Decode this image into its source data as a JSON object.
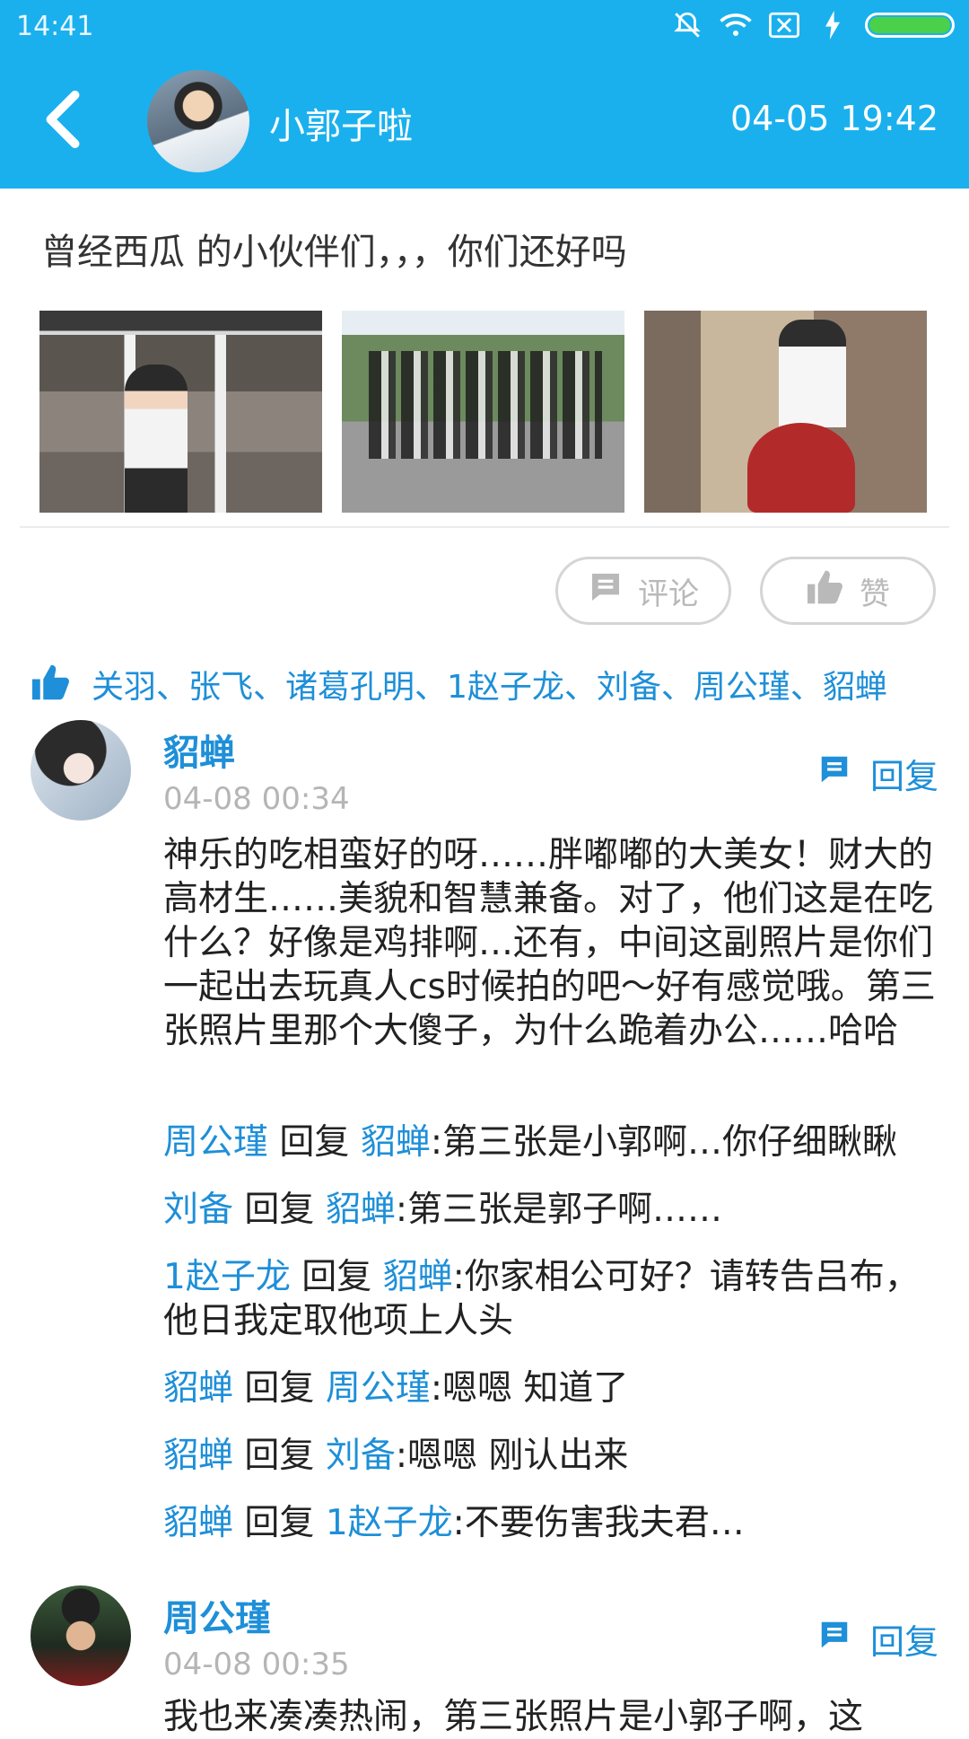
{
  "status_bar": {
    "time": "14:41",
    "icons": [
      "mute-icon",
      "wifi-icon",
      "sim-off-icon",
      "charging-icon",
      "battery-icon"
    ],
    "battery_level": 1.0
  },
  "header": {
    "name": "小郭子啦",
    "datetime": "04-05 19:42"
  },
  "post": {
    "text": "曾经西瓜 的小伙伴们，，，你们还好吗",
    "photo_count": 3
  },
  "actions": {
    "comment_label": "评论",
    "like_label": "赞"
  },
  "likes": {
    "names": "关羽、张飞、诸葛孔明、1赵子龙、刘备、周公瑾、貂蝉"
  },
  "comments": [
    {
      "name": "貂蝉",
      "time": "04-08 00:34",
      "reply_label": "回复",
      "body": "神乐的吃相蛮好的呀……胖嘟嘟的大美女！财大的高材生……美貌和智慧兼备。对了，他们这是在吃什么？好像是鸡排啊…还有，中间这副照片是你们一起出去玩真人cs时候拍的吧～好有感觉哦。第三张照片里那个大傻子，为什么跪着办公……哈哈",
      "replies": [
        {
          "from": "周公瑾",
          "verb": "回复",
          "to": "貂蝉",
          "text": ":第三张是小郭啊…你仔细瞅瞅"
        },
        {
          "from": "刘备",
          "verb": "回复",
          "to": "貂蝉",
          "text": ":第三张是郭子啊……"
        },
        {
          "from": "1赵子龙",
          "verb": "回复",
          "to": "貂蝉",
          "text": ":你家相公可好？请转告吕布，他日我定取他项上人头"
        },
        {
          "from": "貂蝉",
          "verb": "回复",
          "to": "周公瑾",
          "text": ":嗯嗯  知道了"
        },
        {
          "from": "貂蝉",
          "verb": "回复",
          "to": "刘备",
          "text": ":嗯嗯 刚认出来"
        },
        {
          "from": "貂蝉",
          "verb": "回复",
          "to": "1赵子龙",
          "text": ":不要伤害我夫君…"
        }
      ]
    },
    {
      "name": "周公瑾",
      "time": "04-08 00:35",
      "reply_label": "回复",
      "body": "我也来凑凑热闹，第三张照片是小郭子啊，这"
    }
  ]
}
